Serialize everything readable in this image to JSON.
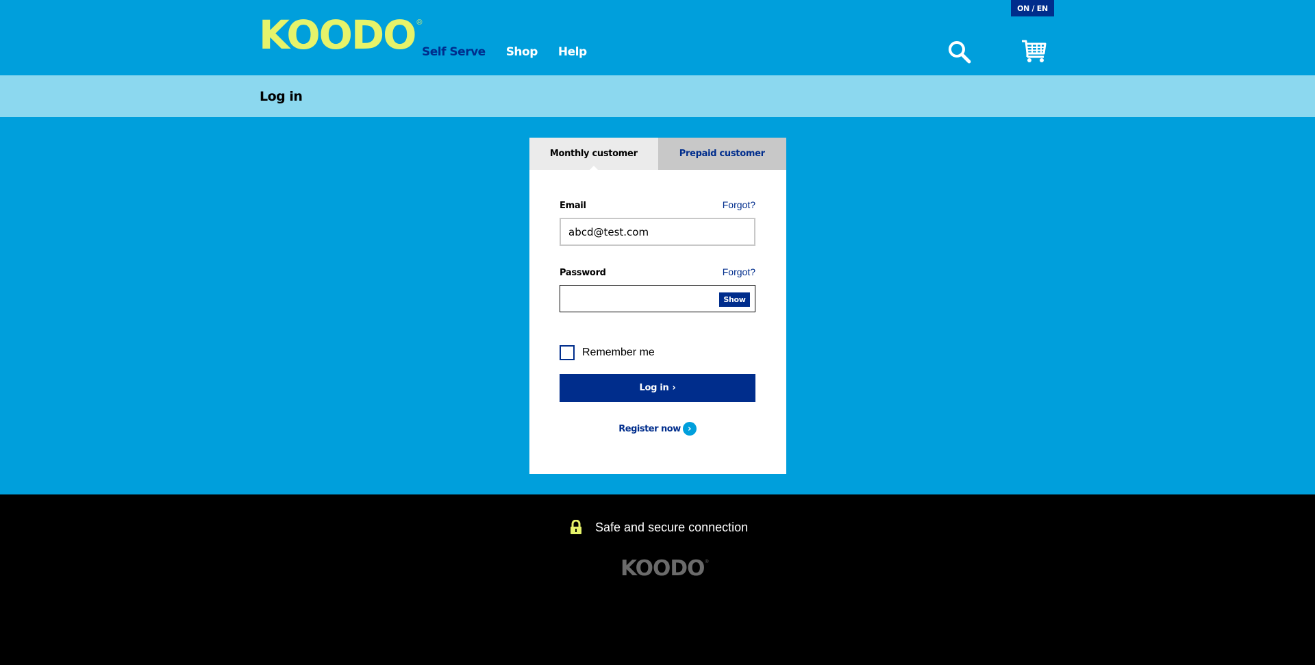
{
  "header": {
    "logo_text": "KOODO",
    "logo_reg": "®",
    "nav": [
      {
        "label": "Self Serve",
        "active": true
      },
      {
        "label": "Shop",
        "active": false
      },
      {
        "label": "Help",
        "active": false
      }
    ],
    "lang_label": "ON / EN",
    "search_icon": "search-icon",
    "cart_icon": "cart-icon"
  },
  "subheader": {
    "title": "Log in"
  },
  "login": {
    "tabs": [
      {
        "label": "Monthly customer",
        "selected": true
      },
      {
        "label": "Prepaid customer",
        "selected": false
      }
    ],
    "email": {
      "label": "Email",
      "forgot": "Forgot?",
      "value": "abcd@test.com"
    },
    "password": {
      "label": "Password",
      "forgot": "Forgot?",
      "value": "",
      "show_label": "Show"
    },
    "remember": {
      "label": "Remember me",
      "checked": false
    },
    "login_button": "Log in",
    "login_chevron": "›",
    "register_label": "Register now",
    "register_chevron": "›"
  },
  "footer": {
    "secure_text": "Safe and secure connection",
    "lock_icon": "lock-icon",
    "logo_text": "KOODO",
    "logo_reg": "®"
  },
  "colors": {
    "brand_blue": "#009fdc",
    "navy": "#002d8c",
    "light_blue": "#8cd8ef",
    "logo_yellow": "#e6f36a",
    "footer_black": "#000000"
  }
}
